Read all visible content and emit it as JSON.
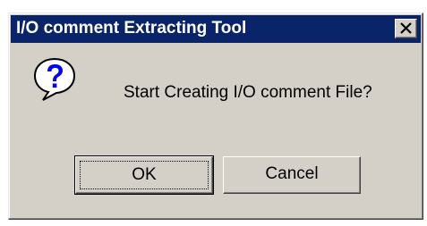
{
  "window": {
    "title": "I/O comment Extracting Tool",
    "close_label": "×"
  },
  "dialog": {
    "icon": "question-icon",
    "message": "Start Creating I/O comment File?"
  },
  "buttons": {
    "ok_label": "OK",
    "cancel_label": "Cancel"
  },
  "colors": {
    "titlebar": "#0a246a",
    "face": "#d4d0c8",
    "icon_blue": "#0000ff"
  }
}
